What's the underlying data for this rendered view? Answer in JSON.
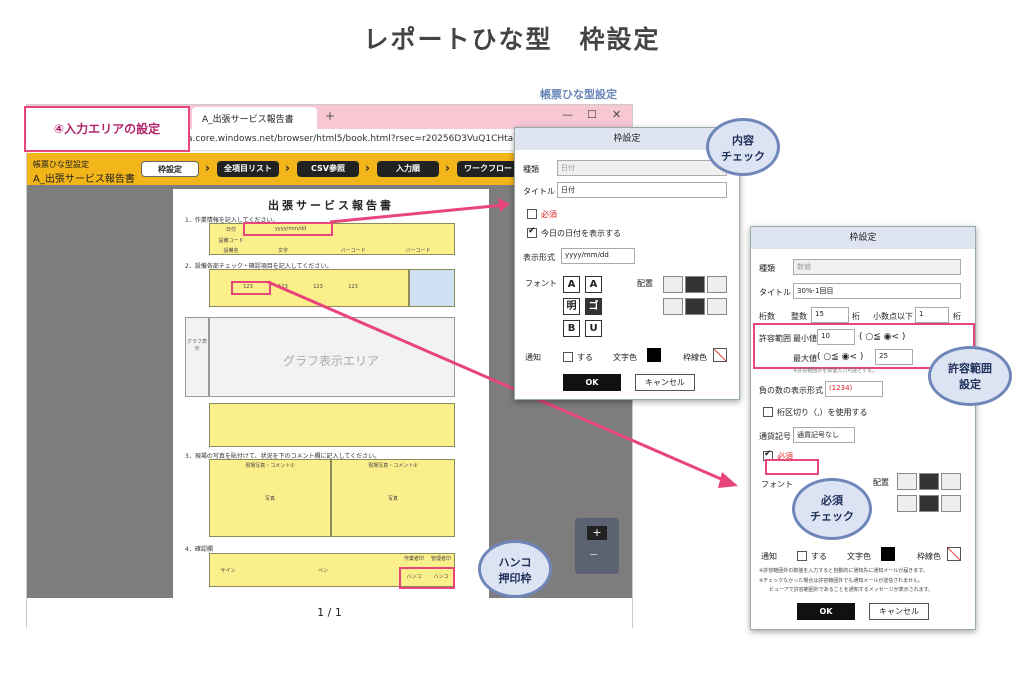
{
  "page_title": "レポートひな型　枠設定",
  "subtitle": "帳票ひな型設定",
  "callout_input_area": "④入力エリアの設定",
  "browser": {
    "tab_label": "A_出張サービス報告書",
    "tab_plus": "+",
    "url": "a.core.windows.net/browser/html5/book.html?rsec=r20256D3VuQ1CHtaR2op7S443G&c...",
    "app_name_line1": "帳票ひな型設定",
    "app_name_line2": "A_出張サービス報告書",
    "steps": [
      "枠設定",
      "全項目リスト",
      "CSV参照",
      "入力順",
      "ワークフロー"
    ],
    "page_indicator": "1 / 1",
    "zoom_plus": "+",
    "zoom_minus": "−"
  },
  "sheet": {
    "title": "出張サービス報告書",
    "sec1": "1．作業情報を記入してください。",
    "sec2": "2．設備各部チェック・確認項目を記入してください。",
    "sec3": "3．現場の写真を貼付けて、状況を下のコメント欄に記入してください。",
    "sec4": "4．確認欄",
    "date_label": "日付",
    "date_value": "yyyy/mm/dd",
    "row2_label": "設備コード",
    "row3_label": "設備名",
    "text_a": "文字",
    "text_b": "バーコード",
    "cell_123": "123",
    "graph_label": "グラフ表示エリア",
    "graph_side": "グラフ表示",
    "photo_comment1": "現場写真・コメント①",
    "photo_comment2": "現場写真・コメント②",
    "photo_word": "写真",
    "sign_label": "サイン",
    "pen_label": "ペン",
    "hanko": "ハンコ",
    "col_work": "作業者印",
    "col_mgr": "管理者印"
  },
  "dialog1": {
    "title": "枠設定",
    "kind_label": "種類",
    "kind_value": "日付",
    "title_label": "タイトル",
    "title_value": "日付",
    "required": "必須",
    "show_today": "今日の日付を表示する",
    "format_label": "表示形式",
    "format_value": "yyyy/mm/dd",
    "font_label": "フォント",
    "align_label": "配置",
    "notify_label": "通知",
    "notify_do": "する",
    "text_color": "文字色",
    "border_color": "枠線色",
    "ok": "OK",
    "cancel": "キャンセル"
  },
  "dialog2": {
    "title": "枠設定",
    "kind_label": "種類",
    "kind_value": "数値",
    "title_label": "タイトル",
    "title_value": "30%-1回目",
    "digits_label": "桁数",
    "int_label": "整数",
    "int_value": "15",
    "keta": "桁",
    "decimal_label": "小数点以下",
    "decimal_value": "1",
    "range_label": "許容範囲",
    "min_label": "最小値",
    "min_value": "10",
    "min_cmp": "( ○≦ ◉< )",
    "max_label": "最大値",
    "max_cmp": "( ○≦ ◉< )",
    "max_value": "25",
    "range_note": "※許容範囲外を数値入力可能とする。",
    "neg_label": "負の数の表示形式",
    "neg_value": "(1234)",
    "comma": "桁区切り（,）を使用する",
    "currency_label": "通貨記号",
    "currency_value": "通貨記号なし",
    "required": "必須",
    "font_label": "フォント",
    "align_label": "配置",
    "notify_label": "通知",
    "notify_do": "する",
    "text_color": "文字色",
    "border_color": "枠線色",
    "note1": "※許容範囲外の数値を入力すると自動的に通知先に通知メールが届きます。",
    "note2": "※チェックなかった場合は許容範囲外でも通知メールが送信されません。",
    "note3": "ビューアで許容範囲外であることを通知するメッセージが表示されます。",
    "ok": "OK",
    "cancel": "キャンセル"
  },
  "bubbles": {
    "content_check": [
      "内容",
      "チェック"
    ],
    "range_setting": [
      "許容範囲",
      "設定"
    ],
    "required_check": [
      "必須",
      "チェック"
    ],
    "hanko": [
      "ハンコ",
      "押印枠"
    ]
  },
  "colors": {
    "pink": "#e8457c",
    "appbar": "#f2b51a",
    "bubble_border": "#6f86b8"
  }
}
